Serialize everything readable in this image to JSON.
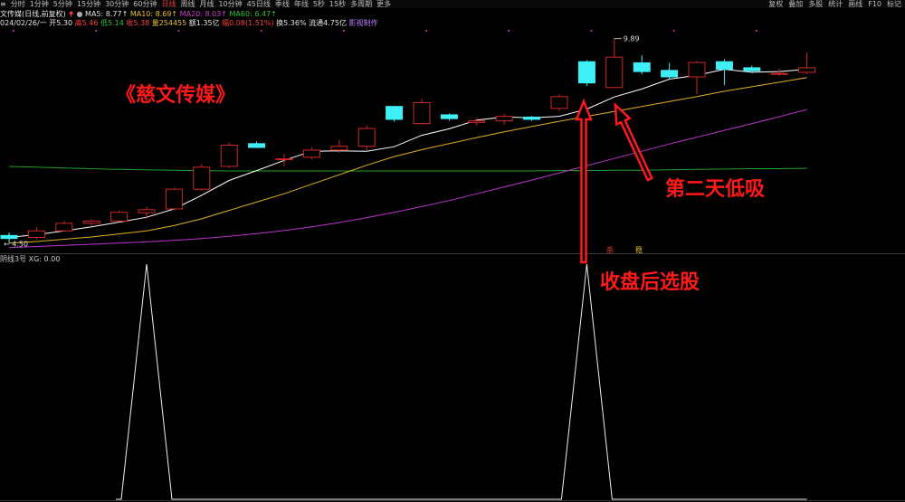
{
  "toolbar": {
    "periods": [
      "分时",
      "1分钟",
      "5分钟",
      "15分钟",
      "30分钟",
      "60分钟",
      "日线",
      "周线",
      "月线",
      "10分钟",
      "45日线",
      "季线",
      "年线",
      "5秒",
      "15秒",
      "多周期",
      "更多"
    ],
    "active_period": "日线",
    "right_buttons": [
      "复权",
      "叠加",
      "多股",
      "统计",
      "画线",
      "F10",
      "标记"
    ],
    "menu_icon": "hamburger-icon"
  },
  "stock": {
    "name_line": "文传媒(日线,前复权)",
    "ma5": "MA5: 8.77↑",
    "ma10": "MA10: 8.69↑",
    "ma20": "MA20: 8.03↑",
    "ma60": "MA60: 6.47↑",
    "date": "024/02/26/一",
    "open": "开5.30",
    "high": "高5.46",
    "low": "低5.14",
    "close": "收5.38",
    "volume": "量254455",
    "amount": "额1.35亿",
    "change": "幅0.08(1.51%)",
    "turnover": "换5.36%",
    "float_value": "流通4.75亿",
    "extra": "影视制作"
  },
  "indicator": {
    "label": "阴线3号",
    "value": "XG: 0.00"
  },
  "annotations": {
    "title": "《慈文传媒》",
    "label_low_buy": "第二天低吸",
    "label_select": "收盘后选股",
    "marker_1": "杀",
    "marker_2": "稳"
  },
  "colors": {
    "up": "#d02828",
    "down": "#3ef0f5",
    "ma5": "#ffffff",
    "ma10": "#e0b020",
    "ma20": "#c030d0",
    "ma60": "#20a020",
    "annotation": "#ff1a1a"
  },
  "chart_data": [
    {
      "type": "candlestick",
      "title": "",
      "price_labels": {
        "high": "9.89",
        "low": "4.50"
      },
      "ylim": [
        4.35,
        10.0
      ],
      "candles": [
        {
          "o": 4.7,
          "h": 4.78,
          "l": 4.5,
          "c": 4.62
        },
        {
          "o": 4.65,
          "h": 4.92,
          "l": 4.6,
          "c": 4.82
        },
        {
          "o": 4.82,
          "h": 5.08,
          "l": 4.8,
          "c": 5.02
        },
        {
          "o": 5.02,
          "h": 5.12,
          "l": 4.96,
          "c": 5.08
        },
        {
          "o": 5.08,
          "h": 5.36,
          "l": 5.05,
          "c": 5.31
        },
        {
          "o": 5.3,
          "h": 5.46,
          "l": 5.14,
          "c": 5.38
        },
        {
          "o": 5.4,
          "h": 5.96,
          "l": 5.36,
          "c": 5.92
        },
        {
          "o": 5.92,
          "h": 6.58,
          "l": 5.88,
          "c": 6.5
        },
        {
          "o": 6.52,
          "h": 7.15,
          "l": 6.48,
          "c": 7.08
        },
        {
          "o": 7.12,
          "h": 7.18,
          "l": 7.0,
          "c": 7.02
        },
        {
          "o": 6.72,
          "h": 6.85,
          "l": 6.52,
          "c": 6.72
        },
        {
          "o": 6.76,
          "h": 7.02,
          "l": 6.7,
          "c": 6.95
        },
        {
          "o": 6.95,
          "h": 7.22,
          "l": 6.88,
          "c": 7.05
        },
        {
          "o": 7.05,
          "h": 7.6,
          "l": 6.95,
          "c": 7.52
        },
        {
          "o": 8.1,
          "h": 8.12,
          "l": 7.7,
          "c": 7.76
        },
        {
          "o": 7.65,
          "h": 8.3,
          "l": 7.62,
          "c": 8.2
        },
        {
          "o": 7.88,
          "h": 7.92,
          "l": 7.72,
          "c": 7.78
        },
        {
          "o": 7.68,
          "h": 7.8,
          "l": 7.6,
          "c": 7.72
        },
        {
          "o": 7.72,
          "h": 7.9,
          "l": 7.62,
          "c": 7.84
        },
        {
          "o": 7.82,
          "h": 7.85,
          "l": 7.72,
          "c": 7.76
        },
        {
          "o": 8.05,
          "h": 8.42,
          "l": 7.98,
          "c": 8.36
        },
        {
          "o": 9.28,
          "h": 9.32,
          "l": 8.64,
          "c": 8.72
        },
        {
          "o": 8.6,
          "h": 9.89,
          "l": 8.58,
          "c": 9.4
        },
        {
          "o": 9.25,
          "h": 9.45,
          "l": 8.95,
          "c": 9.02
        },
        {
          "o": 9.05,
          "h": 9.25,
          "l": 8.8,
          "c": 8.88
        },
        {
          "o": 8.88,
          "h": 9.3,
          "l": 8.42,
          "c": 9.26
        },
        {
          "o": 9.28,
          "h": 9.35,
          "l": 8.66,
          "c": 9.08
        },
        {
          "o": 9.12,
          "h": 9.18,
          "l": 8.98,
          "c": 9.04
        },
        {
          "o": 8.95,
          "h": 9.1,
          "l": 8.9,
          "c": 8.97
        },
        {
          "o": 9.0,
          "h": 9.52,
          "l": 8.95,
          "c": 9.12
        }
      ],
      "ma5": [
        4.65,
        4.72,
        4.82,
        4.93,
        5.05,
        5.18,
        5.4,
        5.76,
        6.15,
        6.41,
        6.68,
        6.92,
        6.93,
        6.92,
        7.04,
        7.34,
        7.51,
        7.74,
        7.82,
        7.8,
        7.84,
        8.03,
        8.35,
        8.56,
        8.82,
        8.92,
        9.08,
        9.0,
        9.02,
        9.08
      ],
      "ma10": [
        4.5,
        4.54,
        4.6,
        4.66,
        4.74,
        4.82,
        4.96,
        5.14,
        5.36,
        5.58,
        5.8,
        6.05,
        6.3,
        6.55,
        6.78,
        6.96,
        7.12,
        7.28,
        7.43,
        7.57,
        7.71,
        7.84,
        7.97,
        8.1,
        8.23,
        8.36,
        8.5,
        8.62,
        8.74,
        8.86
      ],
      "ma20": [
        4.38,
        4.41,
        4.44,
        4.47,
        4.5,
        4.53,
        4.57,
        4.62,
        4.68,
        4.75,
        4.83,
        4.93,
        5.04,
        5.17,
        5.31,
        5.46,
        5.62,
        5.8,
        5.98,
        6.16,
        6.35,
        6.54,
        6.73,
        6.92,
        7.11,
        7.29,
        7.47,
        7.65,
        7.83,
        8.02
      ],
      "ma60": [
        6.52,
        6.5,
        6.48,
        6.46,
        6.44,
        6.43,
        6.42,
        6.41,
        6.4,
        6.4,
        6.4,
        6.4,
        6.4,
        6.4,
        6.4,
        6.4,
        6.4,
        6.4,
        6.4,
        6.4,
        6.41,
        6.41,
        6.42,
        6.42,
        6.43,
        6.44,
        6.45,
        6.46,
        6.46,
        6.47
      ]
    },
    {
      "type": "line",
      "title": "",
      "series": [
        {
          "values": [
            0,
            0,
            0,
            0,
            0,
            1,
            0,
            0,
            0,
            0,
            0,
            0,
            0,
            0,
            0,
            0,
            0,
            0,
            0,
            0,
            0,
            1,
            0,
            0,
            0,
            0,
            0,
            0,
            0,
            0
          ]
        }
      ],
      "ylim": [
        0,
        1
      ]
    }
  ]
}
